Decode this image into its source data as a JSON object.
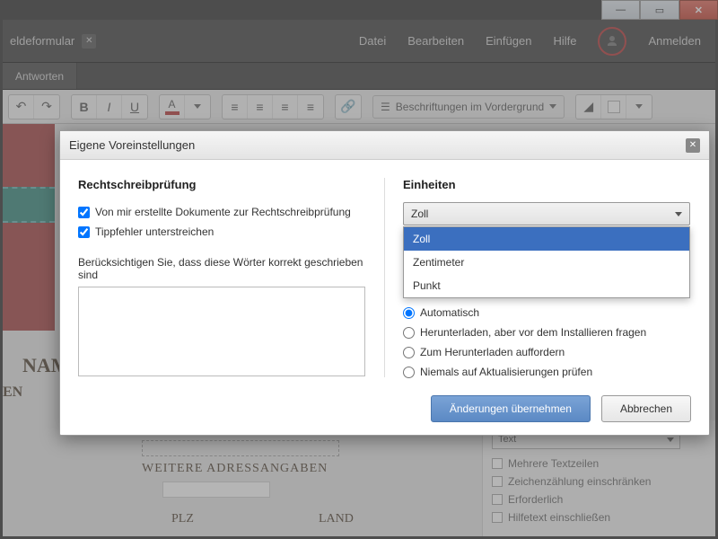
{
  "window": {
    "title": "eldeformular"
  },
  "menubar": {
    "items": [
      "Datei",
      "Bearbeiten",
      "Einfügen",
      "Hilfe"
    ],
    "login": "Anmelden"
  },
  "subtabs": {
    "active": "Antworten"
  },
  "toolbar": {
    "bold": "B",
    "italic": "I",
    "underline": "U",
    "layer_label": "Beschriftungen im Vordergrund"
  },
  "canvas_form": {
    "name_label": "NAM",
    "en_label": "EN",
    "plz_label": "PLZ",
    "land_label": "LAND",
    "extra_label": "WEITERE ADRESSANGABEN"
  },
  "right_panel": {
    "select_value": "Text",
    "checks": [
      "Mehrere Textzeilen",
      "Zeichenzählung einschränken",
      "Erforderlich",
      "Hilfetext einschließen"
    ]
  },
  "modal": {
    "title": "Eigene Voreinstellungen",
    "spellcheck": {
      "heading": "Rechtschreibprüfung",
      "chk1": "Von mir erstellte Dokumente zur Rechtschreibprüfung",
      "chk1_checked": true,
      "chk2": "Tippfehler unterstreichen",
      "chk2_checked": true,
      "desc": "Berücksichtigen Sie, dass diese Wörter korrekt geschrieben sind"
    },
    "units": {
      "heading": "Einheiten",
      "current": "Zoll",
      "options": [
        "Zoll",
        "Zentimeter",
        "Punkt"
      ],
      "selected_index": 0
    },
    "updates": {
      "options": [
        "Automatisch",
        "Herunterladen, aber vor dem Installieren fragen",
        "Zum Herunterladen auffordern",
        "Niemals auf Aktualisierungen prüfen"
      ],
      "selected_index": 0
    },
    "footer": {
      "apply": "Änderungen übernehmen",
      "cancel": "Abbrechen"
    }
  }
}
